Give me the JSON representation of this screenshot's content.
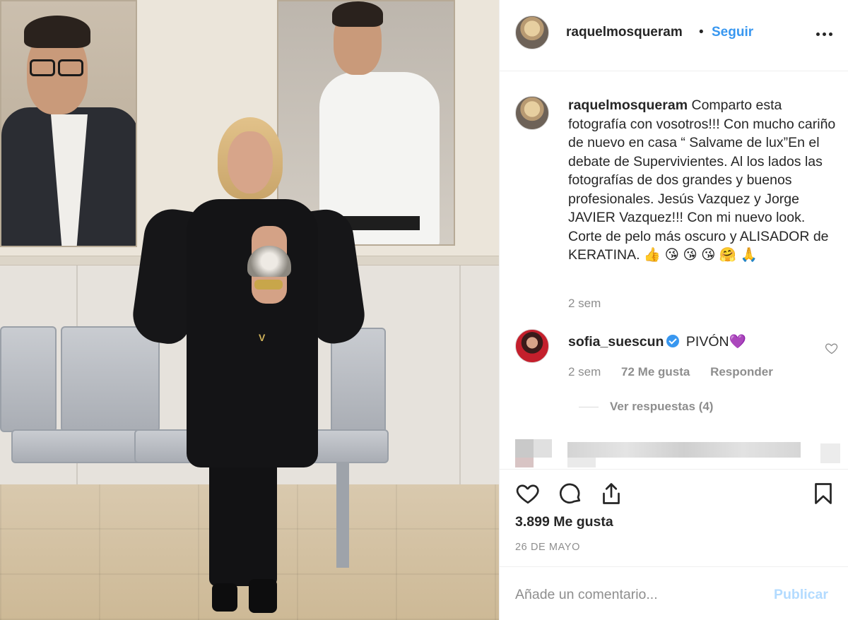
{
  "post": {
    "username": "raquelmosquera​m",
    "dot": "•",
    "follow_label": "Seguir",
    "more_icon": "more-options-icon"
  },
  "caption": {
    "username": "raquelmosqueram",
    "text": "Comparto esta fotografía con vosotros!!! Con mucho cariño de nuevo en casa “ Salvame de lux”En el debate de Supervivientes. Al los lados las fotografías de dos grandes y buenos profesionales. Jesús Vazquez y Jorge JAVIER Vazquez!!! Con mi nuevo look. Corte de pelo más oscuro y ALISADOR de KERATINA. 👍 😘 😘 😘 🤗 🙏",
    "time": "2 sem"
  },
  "comment": {
    "username": "sofia_suescun",
    "text": "PIVÓN💜",
    "time": "2 sem",
    "likes": "72 Me gusta",
    "reply_label": "Responder",
    "view_replies": "Ver respuestas (4)"
  },
  "actions": {
    "likes": "3.899 Me gusta",
    "date": "26 DE MAYO"
  },
  "add_comment": {
    "placeholder": "Añade un comentario...",
    "publish_label": "Publicar"
  },
  "colors": {
    "link_blue": "#3897f0",
    "publish_disabled": "#b3dbff",
    "secondary_text": "#8e8e8e",
    "primary_text": "#262626"
  }
}
